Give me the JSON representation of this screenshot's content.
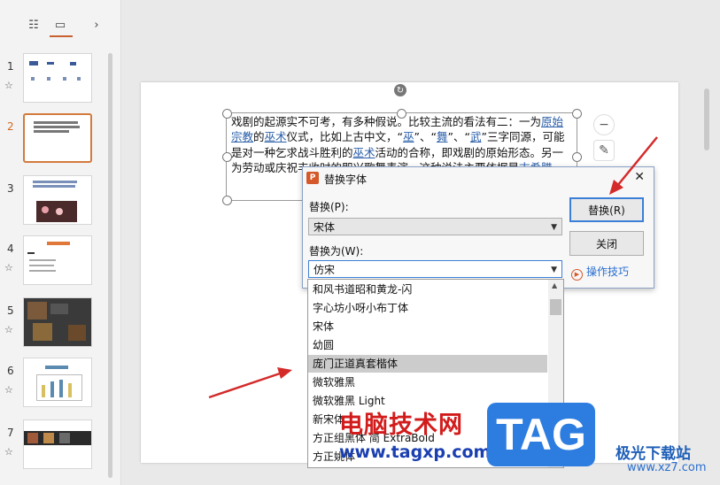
{
  "left_panel": {
    "toolbar": {
      "outline_icon": "list-icon",
      "slides_icon": "slide-view-icon",
      "expand_icon": "chevron-right-icon"
    },
    "slides": [
      {
        "num": "1",
        "has_star": true
      },
      {
        "num": "2",
        "has_star": false,
        "active": true
      },
      {
        "num": "3",
        "has_star": false
      },
      {
        "num": "4",
        "has_star": true
      },
      {
        "num": "5",
        "has_star": true
      },
      {
        "num": "6",
        "has_star": true
      },
      {
        "num": "7",
        "has_star": true
      }
    ]
  },
  "slide_text": {
    "t1": "戏剧的起源实不可考，有多种假说。比较主流的看法有二：一为",
    "l1": "原",
    "l2": "始宗教",
    "t2": "的",
    "l3": "巫术",
    "t3": "仪式，比如上古中文，“",
    "l4": "巫",
    "t4": "”、“",
    "l5": "舞",
    "t5": "”、“",
    "l6": "武",
    "t6": "”三字同源，可能是对一种乞求战斗胜利的",
    "l7": "巫术",
    "t7": "活动的合称，即戏剧的原始形态。另一为劳动或庆祝丰收时的即兴歌舞表演，这种说法主要依据是",
    "l8": "古希腊"
  },
  "dialog": {
    "title": "替换字体",
    "logo": "P",
    "replace_label": "替换(P):",
    "replace_value": "宋体",
    "replace_with_label": "替换为(W):",
    "replace_with_value": "仿宋",
    "replace_button": "替换(R)",
    "close_button": "关闭",
    "tips_link": "操作技巧"
  },
  "font_list": [
    "和风书道昭和黄龙-闪",
    "字心坊小呀小布丁体",
    "宋体",
    "幼圆",
    "庞门正道真套楷体",
    "微软雅黑",
    "微软雅黑 Light",
    "新宋体",
    "方正组黑体 简 ExtraBold",
    "方正姚体"
  ],
  "highlighted_font_index": 4,
  "watermark": {
    "text": "电脑技术网",
    "url": "www.tagxp.com",
    "tag": "TAG",
    "site": "极光下载站",
    "site_url": "www.xz7.com"
  },
  "colors": {
    "accent": "#d47a3c",
    "link": "#2a5ea8",
    "arrow": "#d42a2a",
    "tag_blue": "#2d7de0"
  }
}
